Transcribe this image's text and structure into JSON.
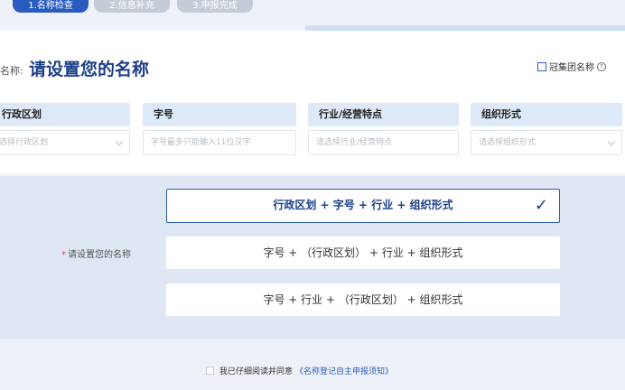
{
  "steps": [
    {
      "label": "1.名称检查",
      "active": true
    },
    {
      "label": "2.信息补充",
      "active": false
    },
    {
      "label": "3.申报完成",
      "active": false
    }
  ],
  "header": {
    "prefix": "名称:",
    "title": "请设置您的名称",
    "group_name_option": "冠集团名称"
  },
  "fields": [
    {
      "label": "行政区划",
      "placeholder": "选择行政区划",
      "dropdown": true
    },
    {
      "label": "字号",
      "placeholder": "字号最多只能输入11位汉字",
      "dropdown": false
    },
    {
      "label": "行业/经营特点",
      "placeholder": "请选择行业/经营特点",
      "dropdown": false
    },
    {
      "label": "组织形式",
      "placeholder": "请选择组织形式",
      "dropdown": true
    }
  ],
  "name_options": {
    "label": "请设置您的名称",
    "items": [
      {
        "text": "行政区划 + 字号 + 行业 + 组织形式",
        "selected": true
      },
      {
        "text": "字号 + （行政区划） + 行业 + 组织形式",
        "selected": false
      },
      {
        "text": "字号 + 行业 + （行政区划） + 组织形式",
        "selected": false
      }
    ]
  },
  "agreement": {
    "text": "我已仔细阅读并同意",
    "link": "《名称登记自主申报须知》"
  },
  "colors": {
    "accent": "#2a5cbf",
    "title": "#1d3f88",
    "panel": "#dee7f3"
  }
}
